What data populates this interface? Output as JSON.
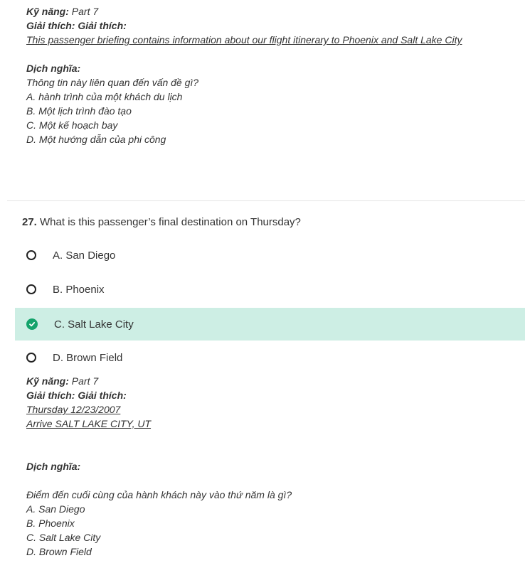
{
  "prev_explanation": {
    "skill_label": "Kỹ năng:",
    "skill_value": " Part 7",
    "expl_label": "Giải thích: Giải thích:",
    "expl_text": "This passenger briefing contains information about our flight itinerary to Phoenix and Salt Lake City",
    "trans_label": "Dịch nghĩa:",
    "trans_lines": [
      "Thông tin này liên quan đến vấn đề gì?",
      "A. hành trình của một khách du lịch",
      "B. Một lịch trình đào tạo",
      "C. Một kế hoạch bay",
      "D. Một hướng dẫn của phi công"
    ]
  },
  "question": {
    "number": "27.",
    "text": " What is this passenger’s final destination on Thursday?",
    "options": [
      {
        "label": "A. San Diego",
        "correct": false
      },
      {
        "label": "B. Phoenix",
        "correct": false
      },
      {
        "label": "C. Salt Lake City",
        "correct": true
      },
      {
        "label": "D. Brown Field",
        "correct": false
      }
    ]
  },
  "explanation": {
    "skill_label": "Kỹ năng:",
    "skill_value": " Part 7",
    "expl_label": "Giải thích: Giải thích:",
    "expl_lines": [
      "Thursday 12/23/2007",
      "Arrive SALT LAKE CITY, UT"
    ],
    "trans_label": "Dịch nghĩa:",
    "trans_lines": [
      "Điểm đến cuối cùng của hành khách này vào thứ năm là gì?",
      "A. San Diego",
      "B. Phoenix",
      "C. Salt Lake City",
      "D. Brown Field"
    ]
  },
  "colors": {
    "correct_bg": "#cdeee4",
    "check": "#14a36b",
    "text": "#333333"
  }
}
